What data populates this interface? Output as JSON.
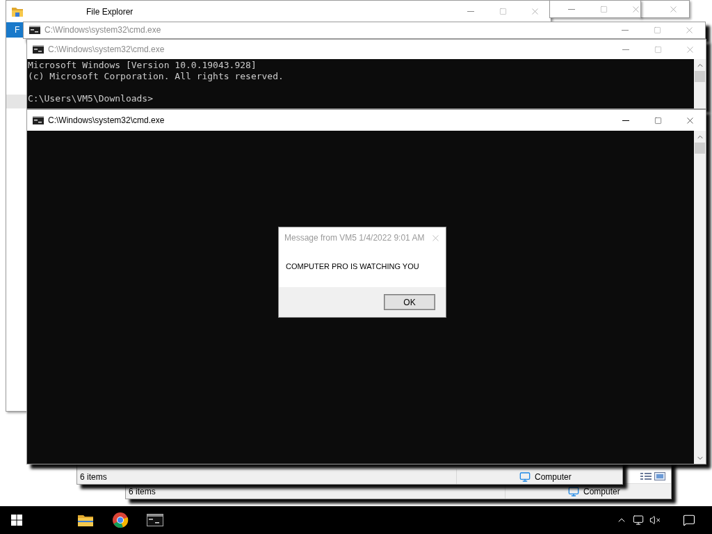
{
  "file_explorer": {
    "title": "File Explorer",
    "ribbon_tab": "F"
  },
  "status_bars": [
    {
      "item_count": "6 items",
      "location": "Computer"
    },
    {
      "item_count": "6 items",
      "location": "Computer"
    }
  ],
  "consoles": [
    {
      "title": "C:\\Windows\\system32\\cmd.exe",
      "active": false
    },
    {
      "title": "C:\\Windows\\system32\\cmd.exe",
      "active": false,
      "lines": [
        "Microsoft Windows [Version 10.0.19043.928]",
        "(c) Microsoft Corporation. All rights reserved."
      ],
      "prompt": "C:\\Users\\VM5\\Downloads>"
    },
    {
      "title": "C:\\Windows\\system32\\cmd.exe",
      "active": true
    }
  ],
  "dialog": {
    "title": "Message from VM5 1/4/2022 9:01 AM",
    "message": "COMPUTER PRO IS WATCHING YOU",
    "button": "OK"
  },
  "taskbar": {
    "apps": [
      {
        "kind": "folder"
      },
      {
        "kind": "browser"
      },
      {
        "kind": "console"
      }
    ]
  }
}
